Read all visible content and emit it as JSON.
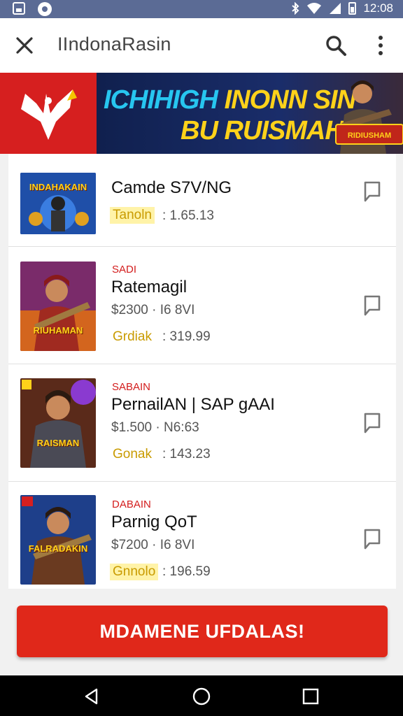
{
  "status_bar": {
    "time": "12:08"
  },
  "app_bar": {
    "title": "IIndonaRasin"
  },
  "banner": {
    "line1_blue": "ICHIHIGH",
    "line1_yellow": "INONN SIN",
    "line2": "BU RUISMAHI",
    "badge": "RIDIUSHAM"
  },
  "items": [
    {
      "tag": "",
      "name": "Camde S7V/NG",
      "price": "",
      "label": "Tanoln",
      "label_highlight": true,
      "value": ": 1.65.13",
      "thumb_text": "INDAHAKAIN",
      "thumb_bg": "#1f4fa8"
    },
    {
      "tag": "SADI",
      "name": "Ratemagil",
      "price": "$2300 · I6 8VI",
      "label": "Grdiak",
      "label_highlight": false,
      "value": ": 319.99",
      "thumb_text": "RIUHAMAN",
      "thumb_bg": "#7a2b6a"
    },
    {
      "tag": "SABAIN",
      "name": "PernailAN | SAP gAAI",
      "price": "$1.500 · N6:63",
      "label": "Gonak",
      "label_highlight": false,
      "value": ": 143.23",
      "thumb_text": "RAISMAN",
      "thumb_bg": "#5a2a1a"
    },
    {
      "tag": "DABAIN",
      "name": "Parnig QoT",
      "price": "$7200 · I6 8VI",
      "label": "Gnnolo",
      "label_highlight": true,
      "value": ": 196.59",
      "thumb_text": "FALRADAKIN",
      "thumb_bg": "#1e3f8a"
    }
  ],
  "cta": {
    "label": "MDAMENE UFDALAS!"
  },
  "colors": {
    "accent": "#e0281a",
    "status_bar": "#5b6b95",
    "banner_bg": "#15224d",
    "tag_red": "#d31c1c",
    "label_yellow": "#c99b00"
  }
}
